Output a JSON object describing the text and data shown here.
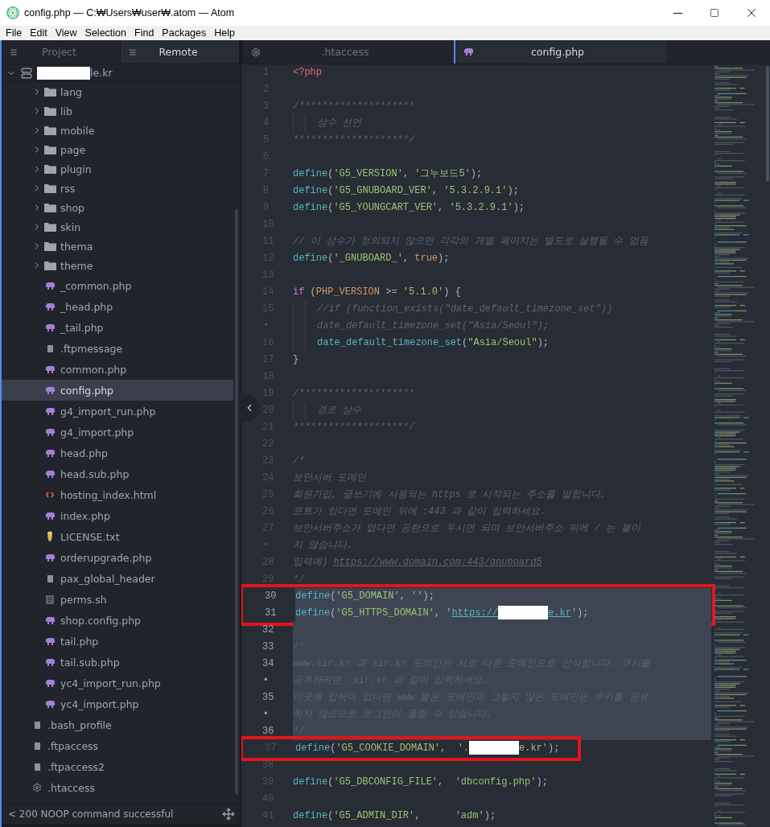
{
  "window": {
    "title": "config.php — C:₩Users₩user₩.atom — Atom"
  },
  "menu": [
    "File",
    "Edit",
    "View",
    "Selection",
    "Find",
    "Packages",
    "Help"
  ],
  "sidebar": {
    "tabs": [
      {
        "label": "Project",
        "selected": false
      },
      {
        "label": "Remote",
        "selected": true
      }
    ],
    "root": {
      "label": "le.kr",
      "redacted": true,
      "expanded": true
    },
    "items": [
      {
        "kind": "group",
        "children": [
          {
            "kind": "folder",
            "label": "lang",
            "expanded": false,
            "selected": false
          },
          {
            "kind": "folder",
            "label": "lib",
            "expanded": false,
            "selected": false
          },
          {
            "kind": "folder",
            "label": "mobile",
            "expanded": false,
            "selected": false
          },
          {
            "kind": "folder",
            "label": "page",
            "expanded": false,
            "selected": false
          },
          {
            "kind": "folder",
            "label": "plugin",
            "expanded": false,
            "selected": false
          },
          {
            "kind": "folder",
            "label": "rss",
            "expanded": false,
            "selected": false
          },
          {
            "kind": "folder",
            "label": "shop",
            "expanded": false,
            "selected": false
          },
          {
            "kind": "folder",
            "label": "skin",
            "expanded": false,
            "selected": false
          },
          {
            "kind": "folder",
            "label": "thema",
            "expanded": false,
            "selected": false
          },
          {
            "kind": "folder",
            "label": "theme",
            "expanded": false,
            "selected": false
          },
          {
            "kind": "php",
            "label": "_common.php",
            "selected": false
          },
          {
            "kind": "php",
            "label": "_head.php",
            "selected": false
          },
          {
            "kind": "php",
            "label": "_tail.php",
            "selected": false
          },
          {
            "kind": "file",
            "label": ".ftpmessage",
            "selected": false
          },
          {
            "kind": "php",
            "label": "common.php",
            "selected": false
          },
          {
            "kind": "php",
            "label": "config.php",
            "selected": true
          },
          {
            "kind": "php",
            "label": "g4_import_run.php",
            "selected": false
          },
          {
            "kind": "php",
            "label": "g4_import.php",
            "selected": false
          },
          {
            "kind": "php",
            "label": "head.php",
            "selected": false
          },
          {
            "kind": "php",
            "label": "head.sub.php",
            "selected": false
          },
          {
            "kind": "html",
            "label": "hosting_index.html",
            "selected": false
          },
          {
            "kind": "php",
            "label": "index.php",
            "selected": false
          },
          {
            "kind": "license",
            "label": "LICENSE.txt",
            "selected": false
          },
          {
            "kind": "php",
            "label": "orderupgrade.php",
            "selected": false
          },
          {
            "kind": "file",
            "label": "pax_global_header",
            "selected": false
          },
          {
            "kind": "shell",
            "label": "perms.sh",
            "selected": false
          },
          {
            "kind": "php",
            "label": "shop.config.php",
            "selected": false
          },
          {
            "kind": "php",
            "label": "tail.php",
            "selected": false
          },
          {
            "kind": "php",
            "label": "tail.sub.php",
            "selected": false
          },
          {
            "kind": "php",
            "label": "yc4_import_run.php",
            "selected": false
          },
          {
            "kind": "php",
            "label": "yc4_import.php",
            "selected": false
          }
        ]
      },
      {
        "kind": "file",
        "label": ".bash_profile",
        "selected": false
      },
      {
        "kind": "file",
        "label": ".ftpaccess",
        "selected": false
      },
      {
        "kind": "file",
        "label": ".ftpaccess2",
        "selected": false
      },
      {
        "kind": "config",
        "label": ".htaccess",
        "selected": false
      }
    ],
    "status": "< 200 NOOP command successful"
  },
  "editor": {
    "tabs": [
      {
        "label": ".htaccess",
        "kind": "config",
        "selected": false
      },
      {
        "label": "config.php",
        "kind": "php",
        "selected": true
      }
    ],
    "lines": [
      {
        "number": "1",
        "selected": false,
        "tokens": [
          {
            "kind": "tag",
            "text": "<?php"
          }
        ]
      },
      {
        "number": "2",
        "selected": false
      },
      {
        "number": "3",
        "selected": false,
        "tokens": [
          {
            "kind": "comment",
            "text": "/********************"
          }
        ]
      },
      {
        "number": "4",
        "selected": false,
        "tokens": [
          {
            "kind": "indent"
          },
          {
            "kind": "indent"
          },
          {
            "kind": "comment",
            "text": "상수 선언"
          }
        ]
      },
      {
        "number": "5",
        "selected": false,
        "tokens": [
          {
            "kind": "comment",
            "text": "********************/"
          }
        ]
      },
      {
        "number": "6",
        "selected": false
      },
      {
        "number": "7",
        "selected": false,
        "tokens": [
          {
            "kind": "function",
            "text": "define"
          },
          {
            "kind": "punct",
            "text": "("
          },
          {
            "kind": "string",
            "text": "'G5_VERSION'"
          },
          {
            "kind": "punct",
            "text": ", "
          },
          {
            "kind": "string",
            "text": "'그누보드5'"
          },
          {
            "kind": "punct",
            "text": ");"
          }
        ]
      },
      {
        "number": "8",
        "selected": false,
        "tokens": [
          {
            "kind": "function",
            "text": "define"
          },
          {
            "kind": "punct",
            "text": "("
          },
          {
            "kind": "string",
            "text": "'G5_GNUBOARD_VER'"
          },
          {
            "kind": "punct",
            "text": ", "
          },
          {
            "kind": "string",
            "text": "'5.3.2.9.1'"
          },
          {
            "kind": "punct",
            "text": ");"
          }
        ]
      },
      {
        "number": "9",
        "selected": false,
        "tokens": [
          {
            "kind": "function",
            "text": "define"
          },
          {
            "kind": "punct",
            "text": "("
          },
          {
            "kind": "string",
            "text": "'G5_YOUNGCART_VER'"
          },
          {
            "kind": "punct",
            "text": ", "
          },
          {
            "kind": "string",
            "text": "'5.3.2.9.1'"
          },
          {
            "kind": "punct",
            "text": ");"
          }
        ]
      },
      {
        "number": "10",
        "selected": false
      },
      {
        "number": "11",
        "selected": false,
        "tokens": [
          {
            "kind": "comment",
            "text": "// 이 상수가 정의되지 않으면 각각의 개별 페이지는 별도로 실행될 수 없음"
          }
        ]
      },
      {
        "number": "12",
        "selected": false,
        "tokens": [
          {
            "kind": "function",
            "text": "define"
          },
          {
            "kind": "punct",
            "text": "("
          },
          {
            "kind": "string",
            "text": "'_GNUBOARD_'"
          },
          {
            "kind": "punct",
            "text": ", "
          },
          {
            "kind": "constant",
            "text": "true"
          },
          {
            "kind": "punct",
            "text": ");"
          }
        ]
      },
      {
        "number": "13",
        "selected": false
      },
      {
        "number": "14",
        "selected": false,
        "tokens": [
          {
            "kind": "keyword",
            "text": "if"
          },
          {
            "kind": "punct",
            "text": " ("
          },
          {
            "kind": "constant",
            "text": "PHP_VERSION"
          },
          {
            "kind": "punct",
            "text": " >= "
          },
          {
            "kind": "string",
            "text": "'5.1.0'"
          },
          {
            "kind": "punct",
            "text": ") {"
          }
        ]
      },
      {
        "number": "15",
        "selected": false,
        "tokens": [
          {
            "kind": "indent"
          },
          {
            "kind": "indent"
          },
          {
            "kind": "comment",
            "text": "//if (function_exists(\"date_default_timezone_set\"))"
          }
        ]
      },
      {
        "number": "•",
        "selected": false,
        "tokens": [
          {
            "kind": "indent"
          },
          {
            "kind": "indent"
          },
          {
            "kind": "comment",
            "text": "date_default_timezone_set(\"Asia/Seoul\");"
          }
        ]
      },
      {
        "number": "16",
        "selected": false,
        "tokens": [
          {
            "kind": "indent"
          },
          {
            "kind": "indent"
          },
          {
            "kind": "function",
            "text": "date_default_timezone_set"
          },
          {
            "kind": "punct",
            "text": "("
          },
          {
            "kind": "string",
            "text": "\"Asia/Seoul\""
          },
          {
            "kind": "punct",
            "text": ");"
          }
        ]
      },
      {
        "number": "17",
        "selected": false,
        "tokens": [
          {
            "kind": "punct",
            "text": "}"
          }
        ]
      },
      {
        "number": "18",
        "selected": false
      },
      {
        "number": "19",
        "selected": false,
        "tokens": [
          {
            "kind": "comment",
            "text": "/********************"
          }
        ]
      },
      {
        "number": "20",
        "selected": false,
        "tokens": [
          {
            "kind": "indent"
          },
          {
            "kind": "indent"
          },
          {
            "kind": "comment",
            "text": "경로 상수"
          }
        ]
      },
      {
        "number": "21",
        "selected": false,
        "tokens": [
          {
            "kind": "comment",
            "text": "********************/"
          }
        ]
      },
      {
        "number": "22",
        "selected": false
      },
      {
        "number": "23",
        "selected": false,
        "tokens": [
          {
            "kind": "comment",
            "text": "/*"
          }
        ]
      },
      {
        "number": "24",
        "selected": false,
        "tokens": [
          {
            "kind": "comment",
            "text": "보안서버 도메인"
          }
        ]
      },
      {
        "number": "25",
        "selected": false,
        "tokens": [
          {
            "kind": "comment",
            "text": "회원가입, 글쓰기에 사용되는 https 로 시작되는 주소를 말합니다."
          }
        ]
      },
      {
        "number": "26",
        "selected": false,
        "tokens": [
          {
            "kind": "comment",
            "text": "포트가 있다면 도메인 뒤에 :443 과 같이 입력하세요."
          }
        ]
      },
      {
        "number": "27",
        "selected": false,
        "tokens": [
          {
            "kind": "comment",
            "text": "보안서버주소가 없다면 공란으로 두시면 되며 보안서버주소 뒤에 / 는 붙이"
          }
        ]
      },
      {
        "number": "•",
        "selected": false,
        "tokens": [
          {
            "kind": "comment",
            "text": "지 않습니다."
          }
        ]
      },
      {
        "number": "28",
        "selected": false,
        "tokens": [
          {
            "kind": "comment",
            "text": "입력예) "
          },
          {
            "kind": "link",
            "text": "https://www.domain.com:443/gnuboard5"
          }
        ]
      },
      {
        "number": "29",
        "selected": false,
        "tokens": [
          {
            "kind": "comment",
            "text": "*/"
          }
        ]
      },
      {
        "number": "30",
        "selected": true,
        "boxed": true,
        "tokens": [
          {
            "kind": "function",
            "text": "define"
          },
          {
            "kind": "punct",
            "text": "("
          },
          {
            "kind": "string",
            "text": "'G5_DOMAIN'"
          },
          {
            "kind": "punct",
            "text": ", "
          },
          {
            "kind": "string",
            "text": "''"
          },
          {
            "kind": "punct",
            "text": ");"
          }
        ]
      },
      {
        "number": "31",
        "selected": true,
        "boxed": true,
        "tokens": [
          {
            "kind": "function",
            "text": "define"
          },
          {
            "kind": "punct",
            "text": "("
          },
          {
            "kind": "string",
            "text": "'G5_HTTPS_DOMAIN'"
          },
          {
            "kind": "punct",
            "text": ", "
          },
          {
            "kind": "string",
            "text": "'"
          },
          {
            "kind": "stringlink",
            "text": "https://"
          },
          {
            "kind": "redacted"
          },
          {
            "kind": "stringlink",
            "text": "e.kr"
          },
          {
            "kind": "string",
            "text": "'"
          },
          {
            "kind": "punct",
            "text": ");"
          }
        ]
      },
      {
        "number": "32",
        "selected": true
      },
      {
        "number": "33",
        "selected": true,
        "tokens": [
          {
            "kind": "comment",
            "text": "/*"
          }
        ]
      },
      {
        "number": "34",
        "selected": true,
        "tokens": [
          {
            "kind": "comment",
            "text": "www.sir.kr 과 sir.kr 도메인은 서로 다른 도메인으로 인식합니다. 쿠키를"
          }
        ]
      },
      {
        "number": "•",
        "selected": true,
        "tokens": [
          {
            "kind": "comment",
            "text": "공유하려면 .sir.kr 과 같이 입력하세요."
          }
        ]
      },
      {
        "number": "35",
        "selected": true,
        "tokens": [
          {
            "kind": "comment",
            "text": "이곳에 입력이 없다면 www 붙은 도메인과 그렇지 않은 도메인은 쿠키를 공유"
          }
        ]
      },
      {
        "number": "•",
        "selected": true,
        "tokens": [
          {
            "kind": "comment",
            "text": "하지 않으므로 로그인이 풀릴 수 있습니다."
          }
        ]
      },
      {
        "number": "36",
        "selected": true,
        "tokens": [
          {
            "kind": "comment",
            "text": "*/"
          }
        ]
      },
      {
        "number": "37",
        "selected": false,
        "boxed": true,
        "tokens": [
          {
            "kind": "function",
            "text": "define"
          },
          {
            "kind": "punct",
            "text": "("
          },
          {
            "kind": "string",
            "text": "'G5_COOKIE_DOMAIN'"
          },
          {
            "kind": "punct",
            "text": ",  "
          },
          {
            "kind": "string",
            "text": "'."
          },
          {
            "kind": "redacted"
          },
          {
            "kind": "string",
            "text": "e.kr'"
          },
          {
            "kind": "punct",
            "text": ");"
          }
        ]
      },
      {
        "number": "38",
        "selected": false
      },
      {
        "number": "39",
        "selected": false,
        "tokens": [
          {
            "kind": "function",
            "text": "define"
          },
          {
            "kind": "punct",
            "text": "("
          },
          {
            "kind": "string",
            "text": "'G5_DBCONFIG_FILE'"
          },
          {
            "kind": "punct",
            "text": ",  "
          },
          {
            "kind": "string",
            "text": "'dbconfig.php'"
          },
          {
            "kind": "punct",
            "text": ");"
          }
        ]
      },
      {
        "number": "40",
        "selected": false
      },
      {
        "number": "41",
        "selected": false,
        "tokens": [
          {
            "kind": "function",
            "text": "define"
          },
          {
            "kind": "punct",
            "text": "("
          },
          {
            "kind": "string",
            "text": "'G5_ADMIN_DIR'"
          },
          {
            "kind": "punct",
            "text": ",      "
          },
          {
            "kind": "string",
            "text": "'adm'"
          },
          {
            "kind": "punct",
            "text": ");"
          }
        ]
      }
    ]
  }
}
